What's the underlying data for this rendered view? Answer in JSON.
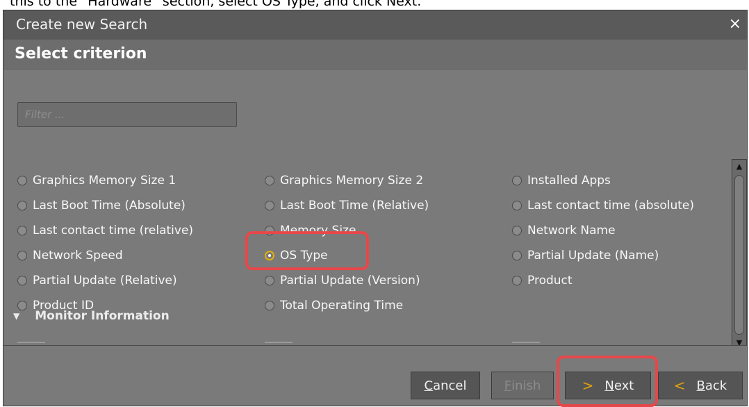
{
  "top_strip_text": "this to the “Hardware” section, select OS Type, and click Next.",
  "dialog": {
    "title": "Create new Search",
    "close_icon": "×",
    "header": "Select criterion"
  },
  "filter": {
    "placeholder": "Filter ..."
  },
  "options": [
    {
      "label": "Graphics Memory Size 1",
      "selected": false
    },
    {
      "label": "Graphics Memory Size 2",
      "selected": false
    },
    {
      "label": "Installed Apps",
      "selected": false
    },
    {
      "label": "Last Boot Time (Absolute)",
      "selected": false
    },
    {
      "label": "Last Boot Time (Relative)",
      "selected": false
    },
    {
      "label": "Last contact time (absolute)",
      "selected": false
    },
    {
      "label": "Last contact time (relative)",
      "selected": false
    },
    {
      "label": "Memory Size",
      "selected": false
    },
    {
      "label": "Network Name",
      "selected": false
    },
    {
      "label": "Network Speed",
      "selected": false
    },
    {
      "label": "OS Type",
      "selected": true
    },
    {
      "label": "Partial Update (Name)",
      "selected": false
    },
    {
      "label": "Partial Update (Relative)",
      "selected": false
    },
    {
      "label": "Partial Update (Version)",
      "selected": false
    },
    {
      "label": "Product",
      "selected": false
    },
    {
      "label": "Product ID",
      "selected": false
    },
    {
      "label": "Total Operating Time",
      "selected": false
    }
  ],
  "group": {
    "label": "Monitor Information"
  },
  "buttons": {
    "cancel": {
      "underline": "C",
      "rest": "ancel"
    },
    "finish": {
      "underline": "F",
      "rest": "inish"
    },
    "next": {
      "chevron": ">",
      "underline": "N",
      "rest": "ext"
    },
    "back": {
      "chevron": "<",
      "underline": "B",
      "rest": "ack"
    }
  },
  "colors": {
    "highlight": "#e8474a",
    "accent_chevron": "#e1a30c",
    "radio_selected_ring": "#e3b00a"
  }
}
